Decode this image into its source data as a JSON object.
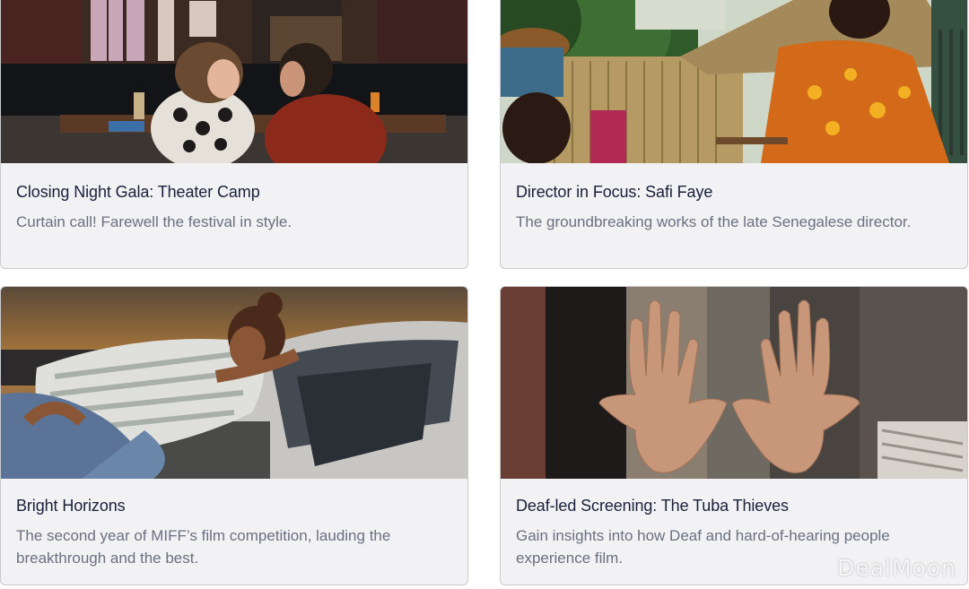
{
  "cards": [
    {
      "title": "Closing Night Gala: Theater Camp",
      "description": "Curtain call! Farewell the festival in style."
    },
    {
      "title": "Director in Focus: Safi Faye",
      "description": "The groundbreaking works of the late Senegalese director."
    },
    {
      "title": "Bright Horizons",
      "description": "The second year of MIFF’s film competition, lauding the breakthrough and the best."
    },
    {
      "title": "Deaf-led Screening: The Tuba Thieves",
      "description": "Gain insights into how Deaf and hard-of-hearing people experience film."
    }
  ],
  "watermark": "DealMoon"
}
